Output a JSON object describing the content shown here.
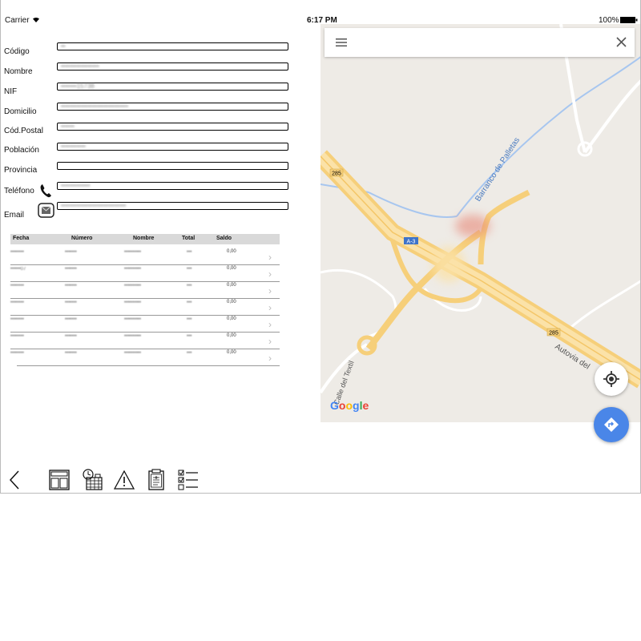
{
  "status_bar": {
    "carrier": "Carrier",
    "time": "6:17 PM",
    "battery": "100%"
  },
  "form": {
    "fields": [
      {
        "label": "Código",
        "value": "••"
      },
      {
        "label": "Nombre",
        "value": "•••••••••••••••••"
      },
      {
        "label": "NIF",
        "value": "•••••••15738"
      },
      {
        "label": "Domicilio",
        "value": "••••••••••••••••••••••••••••••"
      },
      {
        "label": "Cód.Postal",
        "value": "••••••"
      },
      {
        "label": "Población",
        "value": "•••••••••••"
      },
      {
        "label": "Provincia",
        "value": ""
      },
      {
        "label": "Teléfono",
        "value": "•••••••••••••"
      },
      {
        "label": "Email",
        "value": "•••••••••••••••••••••••••••••"
      }
    ]
  },
  "grid": {
    "headers": [
      "Fecha",
      "Número",
      "Nombre",
      "Total",
      "Saldo"
    ],
    "rows": [
      {
        "fecha": "••••••••",
        "numero": "•••••••",
        "nombre": "••••••••••",
        "total": "•••",
        "saldo": "0,00"
      },
      {
        "fecha": "••••••07",
        "numero": "•••••••",
        "nombre": "••••••••••",
        "total": "•••",
        "saldo": "0,00"
      },
      {
        "fecha": "••••••••",
        "numero": "•••••••",
        "nombre": "••••••••••",
        "total": "•••",
        "saldo": "0,00"
      },
      {
        "fecha": "••••••••",
        "numero": "•••••••",
        "nombre": "••••••••••",
        "total": "•••",
        "saldo": "0,00"
      },
      {
        "fecha": "••••••••",
        "numero": "•••••••",
        "nombre": "••••••••••",
        "total": "•••",
        "saldo": "0,00"
      },
      {
        "fecha": "••••••••",
        "numero": "•••••••",
        "nombre": "••••••••••",
        "total": "•••",
        "saldo": "0,00"
      },
      {
        "fecha": "••••••••",
        "numero": "•••••••",
        "nombre": "••••••••••",
        "total": "•••",
        "saldo": "0,00"
      }
    ]
  },
  "map": {
    "labels": {
      "barranco": "Barranco de Palletas",
      "autovia": "Autovia del",
      "calle": "Calle del Textil",
      "a3": "A-3",
      "r285a": "285",
      "r285b": "285"
    },
    "google_logo": {
      "g1": "G",
      "o1": "o",
      "o2": "o",
      "g2": "g",
      "l": "l",
      "e": "e"
    },
    "colors": {
      "background": "#eeebe6",
      "highway": "#f6cf7a",
      "road": "#ffffff",
      "water": "#a7c6ef",
      "direction_button": "#4a86e8"
    }
  },
  "toolbar": {
    "icons": [
      "back-icon",
      "dashboard-icon",
      "calendar-clock-icon",
      "warning-icon",
      "clipboard-icon",
      "checklist-icon"
    ]
  }
}
